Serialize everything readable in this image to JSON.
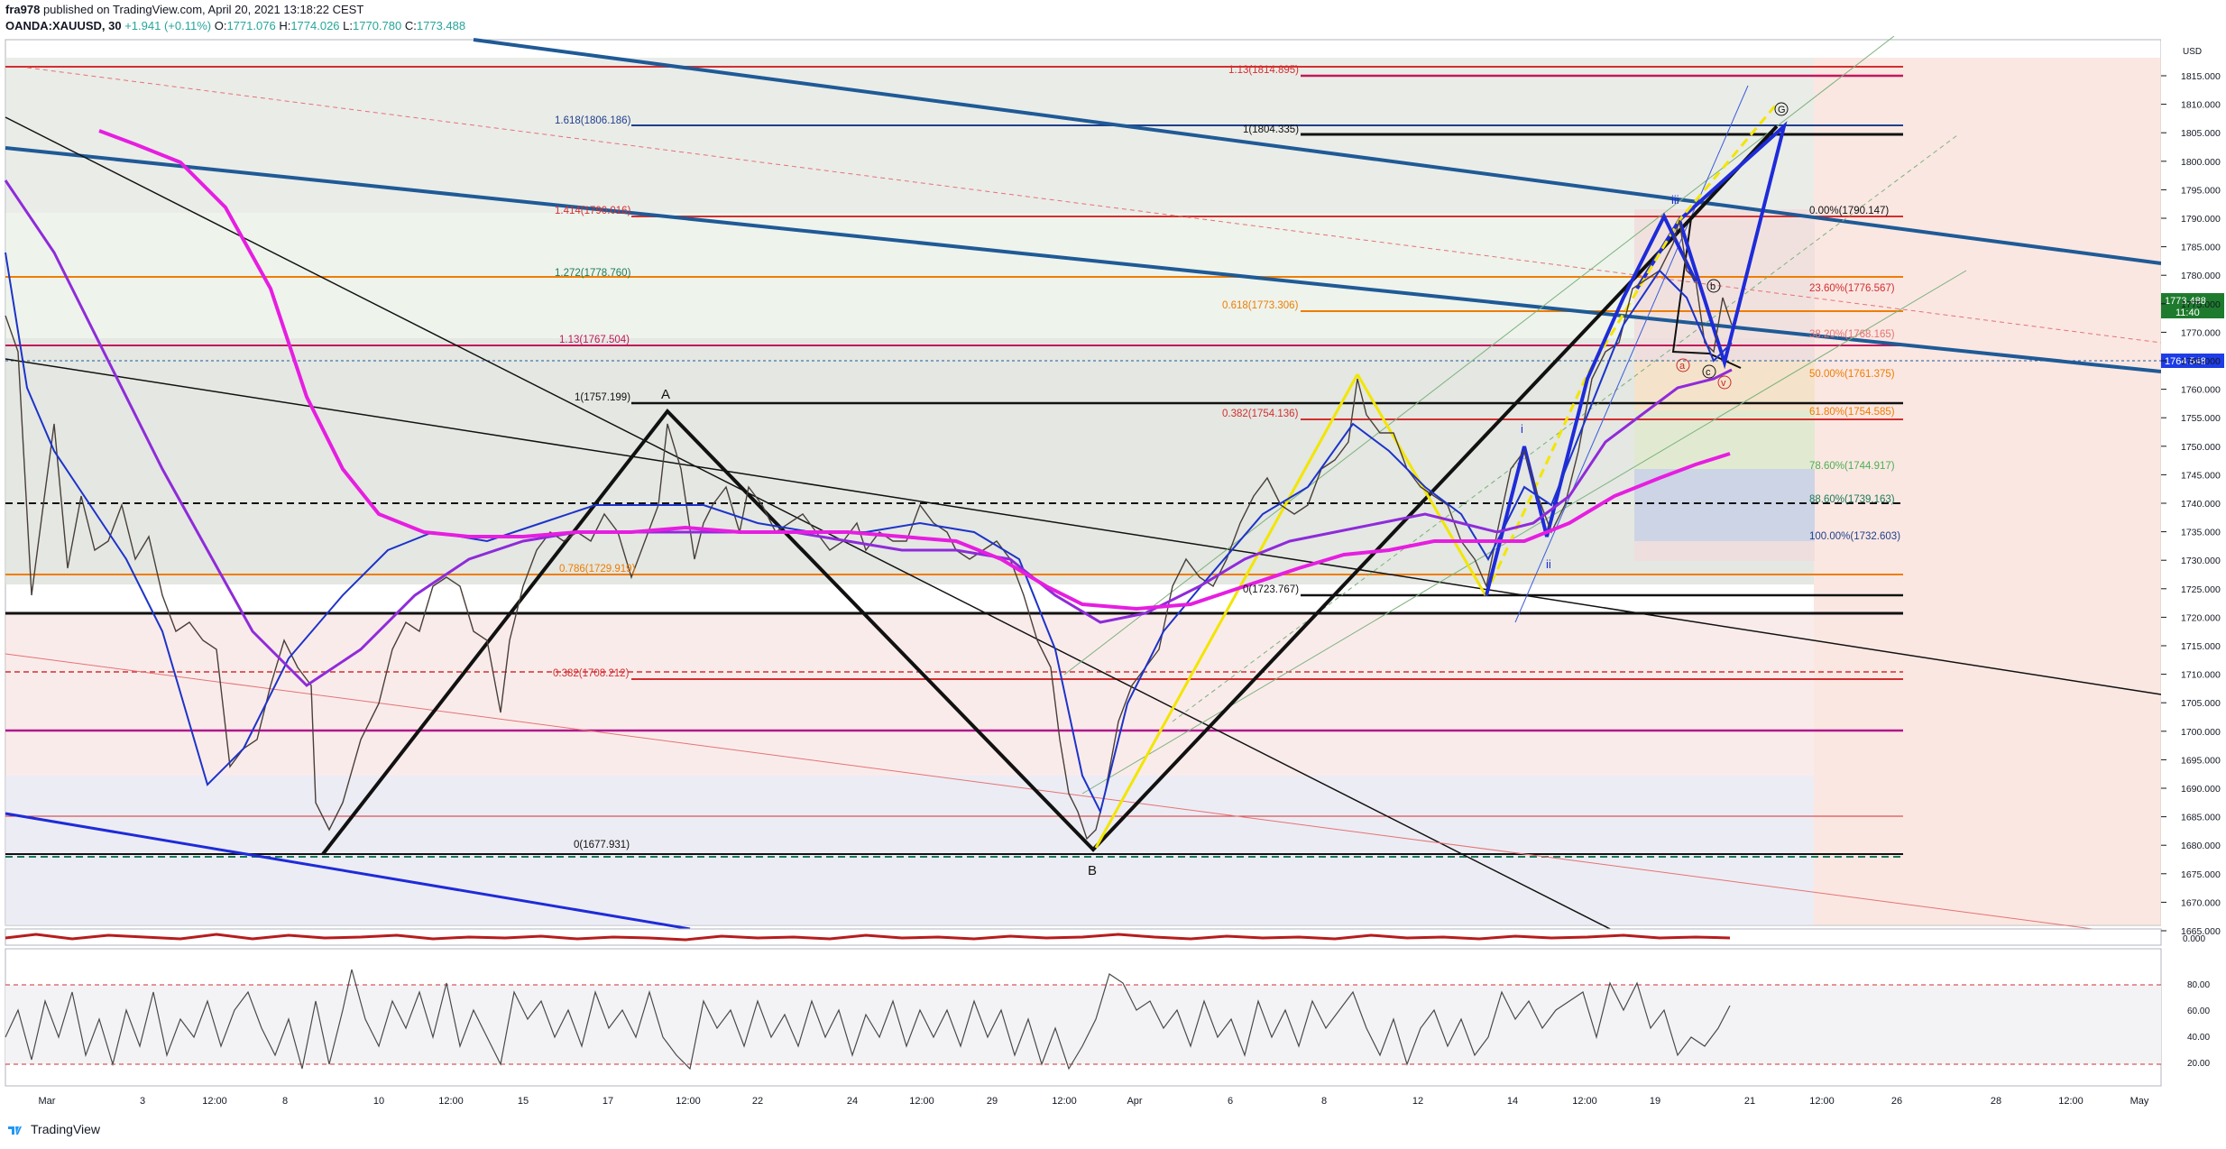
{
  "header": {
    "author": "fra978",
    "published_text": "published on TradingView.com, April 20, 2021 13:18:22 CEST",
    "symbol": "OANDA:XAUUSD, 30",
    "change": "+1.941 (+0.11%)",
    "o_label": "O:",
    "o_value": "1771.076",
    "h_label": "H:",
    "h_value": "1774.026",
    "l_label": "L:",
    "l_value": "1770.780",
    "c_label": "C:",
    "c_value": "1773.488"
  },
  "price_axis": {
    "currency": "USD",
    "ticks": [
      "1815.000",
      "1810.000",
      "1805.000",
      "1800.000",
      "1795.000",
      "1790.000",
      "1785.000",
      "1780.000",
      "1775.000",
      "1770.000",
      "1765.000",
      "1760.000",
      "1755.000",
      "1750.000",
      "1745.000",
      "1740.000",
      "1735.000",
      "1730.000",
      "1725.000",
      "1720.000",
      "1715.000",
      "1710.000",
      "1705.000",
      "1700.000",
      "1695.000",
      "1690.000",
      "1685.000",
      "1680.000",
      "1675.000",
      "1670.000",
      "1665.000"
    ],
    "current_price": "1773.488",
    "countdown": "11:40",
    "line_price": "1764.548"
  },
  "lower_axis": {
    "top_value": "0.000",
    "rsi_ticks": [
      "80.00",
      "60.00",
      "40.00",
      "20.00"
    ]
  },
  "time_axis": [
    "Mar",
    "3",
    "12:00",
    "8",
    "10",
    "12:00",
    "15",
    "17",
    "12:00",
    "22",
    "24",
    "12:00",
    "29",
    "12:00",
    "Apr",
    "6",
    "8",
    "12",
    "14",
    "12:00",
    "19",
    "21",
    "12:00",
    "26",
    "28",
    "12:00",
    "May"
  ],
  "fib_labels": {
    "f1": "1.13(1814.895)",
    "f2": "1.618(1806.186)",
    "f3": "1(1804.335)",
    "f4": "1.414(1790.016)",
    "f5": "1.272(1778.760)",
    "f6": "0.618(1773.306)",
    "f7": "1.13(1767.504)",
    "f8": "1(1757.199)",
    "f9": "0.382(1754.136)",
    "f10": "0(1723.767)",
    "f11": "0.382(1708.212)",
    "f12": "0(1677.931)",
    "f13": "0.786(1729.919)",
    "r0": "0.00%(1790.147)",
    "r1": "23.60%(1776.567)",
    "r2": "38.20%(1768.165)",
    "r3": "50.00%(1761.375)",
    "r4": "61.80%(1754.585)",
    "r5": "78.60%(1744.917)",
    "r6": "88.60%(1739.163)",
    "r7": "100.00%(1732.603)"
  },
  "wave_labels": {
    "A": "A",
    "B": "B",
    "iii": "iii",
    "i": "i",
    "ii": "ii",
    "a": "a",
    "b": "b",
    "c": "c",
    "v": "v",
    "G": "G"
  },
  "colors": {
    "background": "#ffffff",
    "price_line": "#4a4a4a",
    "ema_blue": "#1d33c9",
    "ema_purple": "#8f2bd9",
    "ema_magenta": "#e61ee0",
    "trend_blue": "#1f5a96",
    "fib_red": "#d32f2f",
    "fib_orange": "#ef7d00",
    "current_price_bg": "#1e7b2d",
    "marker_bg": "#1e3de6"
  },
  "footer": {
    "brand": "TradingView"
  }
}
